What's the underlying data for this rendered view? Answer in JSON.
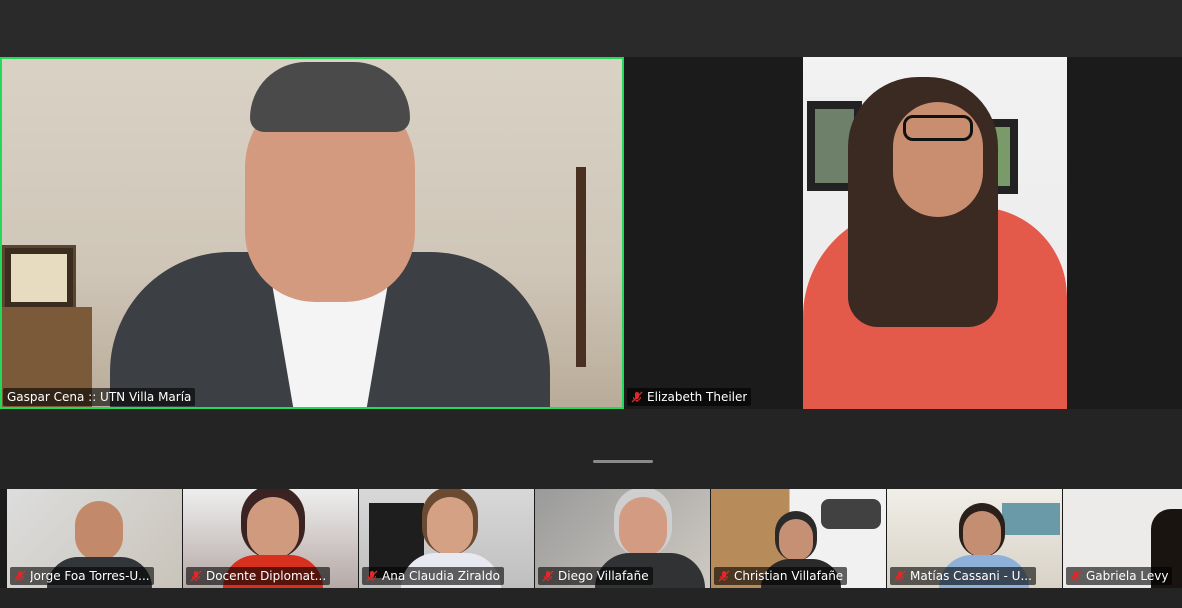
{
  "colors": {
    "active_speaker": "#23d959",
    "mute": "#e02828"
  },
  "main": {
    "speaker": {
      "name": "Gaspar Cena :: UTN Villa María",
      "muted": false
    },
    "second": {
      "name": "Elizabeth Theiler",
      "muted": true
    }
  },
  "gallery": {
    "participants": [
      {
        "name": "Jorge Foa Torres-U...",
        "muted": true
      },
      {
        "name": "Docente Diplomat...",
        "muted": true
      },
      {
        "name": "Ana Claudia Ziraldo",
        "muted": true
      },
      {
        "name": "Diego Villafañe",
        "muted": true
      },
      {
        "name": "Christian Villafañe",
        "muted": true
      },
      {
        "name": "Matías Cassani - U...",
        "muted": true
      },
      {
        "name": "Gabriela Levy",
        "muted": true
      }
    ]
  }
}
